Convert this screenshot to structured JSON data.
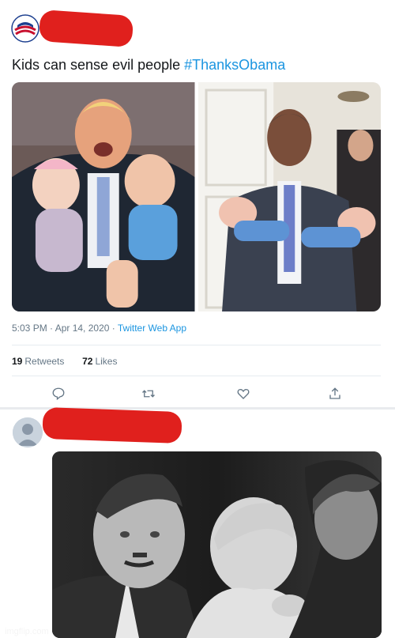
{
  "tweet": {
    "text": "Kids can sense evil people ",
    "hashtag": "#ThanksObama",
    "time": "5:03 PM · Apr 14, 2020 · ",
    "client": "Twitter Web App",
    "retweets_count": "19",
    "retweets_label": "Retweets",
    "likes_count": "72",
    "likes_label": "Likes"
  },
  "actions": [
    "reply-icon",
    "retweet-icon",
    "like-icon",
    "share-icon"
  ],
  "images": {
    "left_photo": "man in suit holding two crying babies",
    "right_photo": "man in suit holding two sleeping babies",
    "reply_photo": "black-and-white photo of smiling man with infant"
  },
  "watermark": "imgflip.com",
  "colors": {
    "accent": "#1b95e0",
    "redaction": "#e0201d",
    "muted": "#657786"
  }
}
